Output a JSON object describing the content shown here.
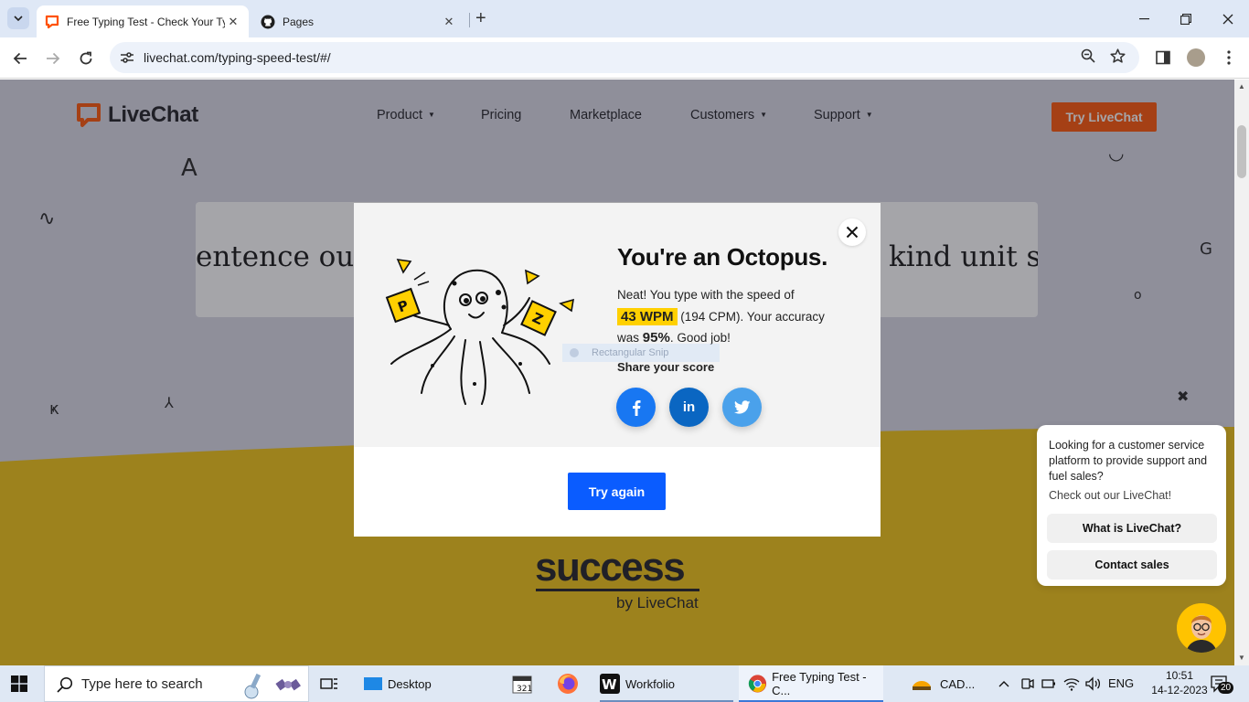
{
  "browser": {
    "tabs": [
      {
        "title": "Free Typing Test - Check Your Typing Speed",
        "active": true
      },
      {
        "title": "Pages",
        "active": false
      }
    ],
    "url": "livechat.com/typing-speed-test/#/"
  },
  "site": {
    "logo_text": "LiveChat",
    "nav": [
      {
        "label": "Product",
        "dropdown": true
      },
      {
        "label": "Pricing",
        "dropdown": false
      },
      {
        "label": "Marketplace",
        "dropdown": false
      },
      {
        "label": "Customers",
        "dropdown": true
      },
      {
        "label": "Support",
        "dropdown": true
      }
    ],
    "cta": "Try LiveChat",
    "sentence_left": "entence our",
    "sentence_right": "kind unit st",
    "brand_word": "success",
    "brand_by": "by LiveChat"
  },
  "modal": {
    "title": "You're an Octopus.",
    "text_1": "Neat! You type with the speed of",
    "wpm": "43 WPM",
    "cpm_text": "(194 CPM). Your accuracy",
    "was": "was",
    "accuracy": "95%",
    "good_job": ". Good job!",
    "share_label": "Share your score",
    "snip_label": "Rectangular Snip",
    "try_again": "Try again",
    "social": [
      {
        "name": "facebook",
        "glyph": "f",
        "color": "#1877f2"
      },
      {
        "name": "linkedin",
        "glyph": "in",
        "color": "#0a66c2"
      },
      {
        "name": "twitter",
        "glyph": "t",
        "color": "#4aa1eb"
      }
    ]
  },
  "chat": {
    "question": "Looking for a customer service platform to provide support and fuel sales?",
    "sub": "Check out our LiveChat!",
    "btn_1": "What is LiveChat?",
    "btn_2": "Contact sales"
  },
  "taskbar": {
    "search_placeholder": "Type here to search",
    "desktop_label": "Desktop",
    "workfolio_label": "Workfolio",
    "chrome_label": "Free Typing Test - C...",
    "cad_label": "CAD...",
    "lang": "ENG",
    "time": "10:51",
    "date": "14-12-2023",
    "notifications": "20"
  },
  "colors": {
    "accent_orange": "#ff5100",
    "modal_blue": "#0a5cff",
    "wpm_highlight": "#ffd000",
    "page_yellow": "#f2c30f"
  }
}
